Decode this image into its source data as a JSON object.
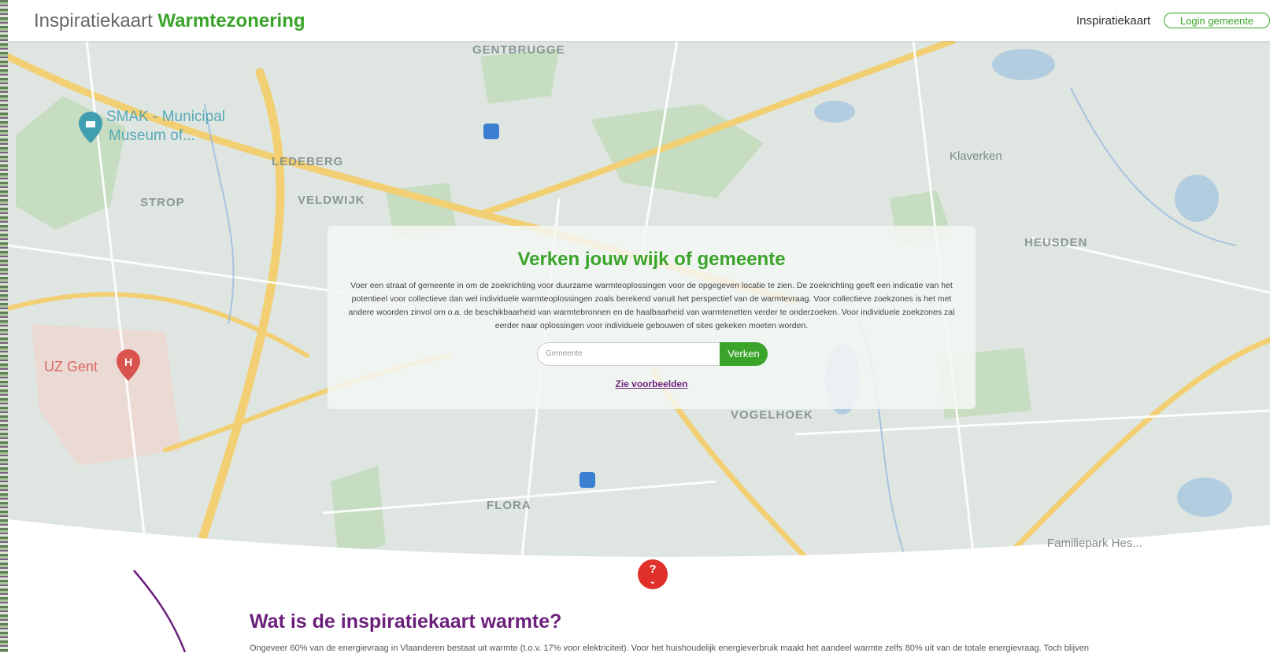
{
  "header": {
    "brand_light": "Inspiratiekaart",
    "brand_strong": "Warmtezonering",
    "nav_link": "Inspiratiekaart",
    "login_label": "Login gemeente"
  },
  "map": {
    "labels": {
      "gentbrugge": "GENTBRUGGE",
      "ledeberg": "LEDEBERG",
      "veldwijk": "VELDWIJK",
      "strop": "STROP",
      "smak": "SMAK - Municipal",
      "smak2": "Museum of...",
      "uzgent": "UZ Gent",
      "klaverken": "Klaverken",
      "heusden": "HEUSDEN",
      "vogelhoek": "VOGELHOEK",
      "flora": "FLORA",
      "familiepark": "Familiepark Hes..."
    }
  },
  "search_panel": {
    "title": "Verken jouw wijk of gemeente",
    "description": "Voer een straat of gemeente in om de zoekrichting voor duurzame warmteoplossingen voor de opgegeven locatie te zien. De zoekrichting geeft een indicatie van het potentieel voor collectieve dan wel individuele warmteoplossingen zoals berekend vanuit het perspectief van de warmtevraag. Voor collectieve zoekzones is het met andere woorden zinvol om o.a. de beschikbaarheid van warmtebronnen en de haalbaarheid van warmtenetten verder te onderzoeken. Voor individuele zoekzones zal eerder naar oplossingen voor individuele gebouwen of sites gekeken moeten worden.",
    "input_placeholder": "Gemeente",
    "button_label": "Verken",
    "examples_link": "Zie voorbeelden"
  },
  "help_button": {
    "symbol": "?",
    "chevron": "⌄"
  },
  "info_section": {
    "title": "Wat is de inspiratiekaart warmte?",
    "text": "Ongeveer 60% van de energievraag in Vlaanderen bestaat uit warmte (t.o.v. 17% voor elektriciteit). Voor het huishoudelijk energieverbruik maakt het aandeel warmte zelfs 80% uit van de totale energievraag. Toch blijven"
  },
  "colors": {
    "brand_green": "#3aa42a",
    "purple": "#6b1f7b",
    "help_red": "#e0302a"
  }
}
